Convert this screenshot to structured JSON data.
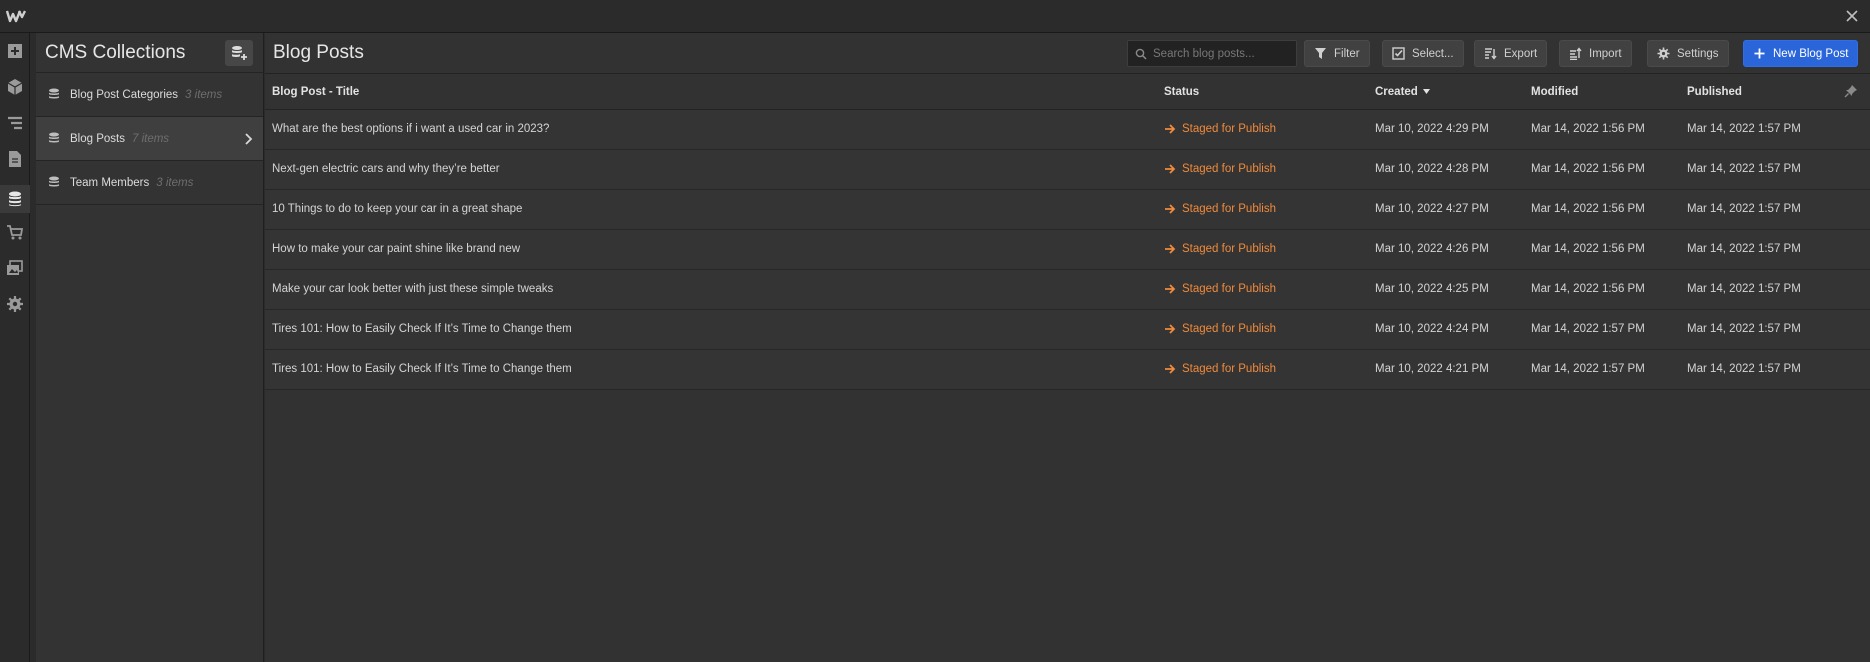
{
  "app": {
    "logo_letter": "W"
  },
  "sidebar": {
    "title": "CMS Collections",
    "collections": [
      {
        "name": "Blog Post Categories",
        "count": "3 items"
      },
      {
        "name": "Blog Posts",
        "count": "7 items"
      },
      {
        "name": "Team Members",
        "count": "3 items"
      }
    ]
  },
  "main": {
    "title": "Blog Posts",
    "search_placeholder": "Search blog posts...",
    "buttons": {
      "filter": "Filter",
      "select": "Select...",
      "export": "Export",
      "import": "Import",
      "settings": "Settings",
      "new": "New Blog Post"
    },
    "columns": {
      "title": "Blog Post - Title",
      "status": "Status",
      "created": "Created",
      "modified": "Modified",
      "published": "Published"
    },
    "rows": [
      {
        "title": "What are the best options if i want a used car in 2023?",
        "status": "Staged for Publish",
        "created": "Mar 10, 2022 4:29 PM",
        "modified": "Mar 14, 2022 1:56 PM",
        "published": "Mar 14, 2022 1:57 PM"
      },
      {
        "title": "Next-gen electric cars and why they’re better",
        "status": "Staged for Publish",
        "created": "Mar 10, 2022 4:28 PM",
        "modified": "Mar 14, 2022 1:56 PM",
        "published": "Mar 14, 2022 1:57 PM"
      },
      {
        "title": "10 Things to do to keep your car in a great shape",
        "status": "Staged for Publish",
        "created": "Mar 10, 2022 4:27 PM",
        "modified": "Mar 14, 2022 1:56 PM",
        "published": "Mar 14, 2022 1:57 PM"
      },
      {
        "title": "How to make your car paint shine like brand new",
        "status": "Staged for Publish",
        "created": "Mar 10, 2022 4:26 PM",
        "modified": "Mar 14, 2022 1:56 PM",
        "published": "Mar 14, 2022 1:57 PM"
      },
      {
        "title": "Make your car look better with just these simple tweaks",
        "status": "Staged for Publish",
        "created": "Mar 10, 2022 4:25 PM",
        "modified": "Mar 14, 2022 1:56 PM",
        "published": "Mar 14, 2022 1:57 PM"
      },
      {
        "title": "Tires 101: How to Easily Check If It’s Time to Change them",
        "status": "Staged for Publish",
        "created": "Mar 10, 2022 4:24 PM",
        "modified": "Mar 14, 2022 1:57 PM",
        "published": "Mar 14, 2022 1:57 PM"
      },
      {
        "title": "Tires 101: How to Easily Check If It’s Time to Change them",
        "status": "Staged for Publish",
        "created": "Mar 10, 2022 4:21 PM",
        "modified": "Mar 14, 2022 1:57 PM",
        "published": "Mar 14, 2022 1:57 PM"
      }
    ]
  },
  "colors": {
    "accent": "#2a66d9",
    "status_staged": "#f08a3c"
  }
}
